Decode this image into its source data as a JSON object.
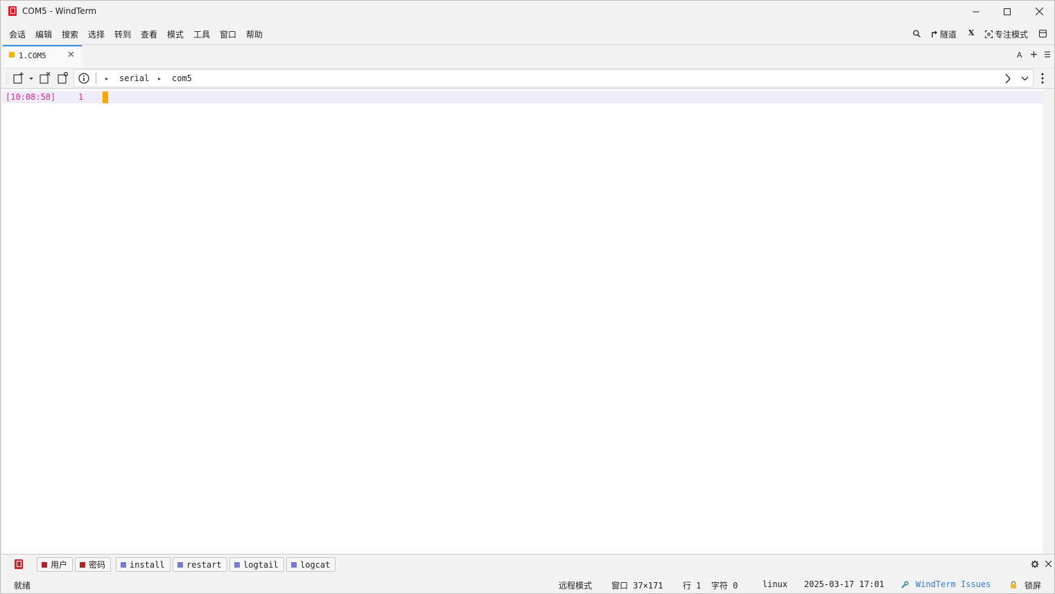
{
  "window": {
    "title": "COM5 - WindTerm"
  },
  "menu": {
    "items": [
      "会话",
      "编辑",
      "搜索",
      "选择",
      "转到",
      "查看",
      "模式",
      "工具",
      "窗口",
      "帮助"
    ],
    "right": {
      "tunnel_label": "隧道",
      "x_label": "X",
      "focus_label": "专注模式"
    }
  },
  "tabs": [
    {
      "label": "1.COM5",
      "active": true,
      "dot_color": "#f5b400"
    }
  ],
  "tabbar_right": {
    "font_label": "A"
  },
  "address": {
    "crumbs": [
      "serial",
      "com5"
    ]
  },
  "terminal": {
    "timestamp": "[10:08:58]",
    "line_number": "1",
    "cursor_color": "#f5a800",
    "timestamp_color": "#e0229a"
  },
  "quickbar": {
    "buttons": [
      {
        "label": "用户",
        "color": "#b22222"
      },
      {
        "label": "密码",
        "color": "#b22222"
      },
      {
        "label": "install",
        "color": "#7a7ad6"
      },
      {
        "label": "restart",
        "color": "#7a7ad6"
      },
      {
        "label": "logtail",
        "color": "#7a7ad6"
      },
      {
        "label": "logcat",
        "color": "#7a7ad6"
      }
    ]
  },
  "status": {
    "ready": "就绪",
    "mode": "远程模式",
    "window_label": "窗口 37×171",
    "row_label": "行 1",
    "char_label": "字符 0",
    "os": "linux",
    "datetime": "2025-03-17 17:01",
    "issues_link": "WindTerm Issues",
    "lock_label": "锁屏"
  }
}
